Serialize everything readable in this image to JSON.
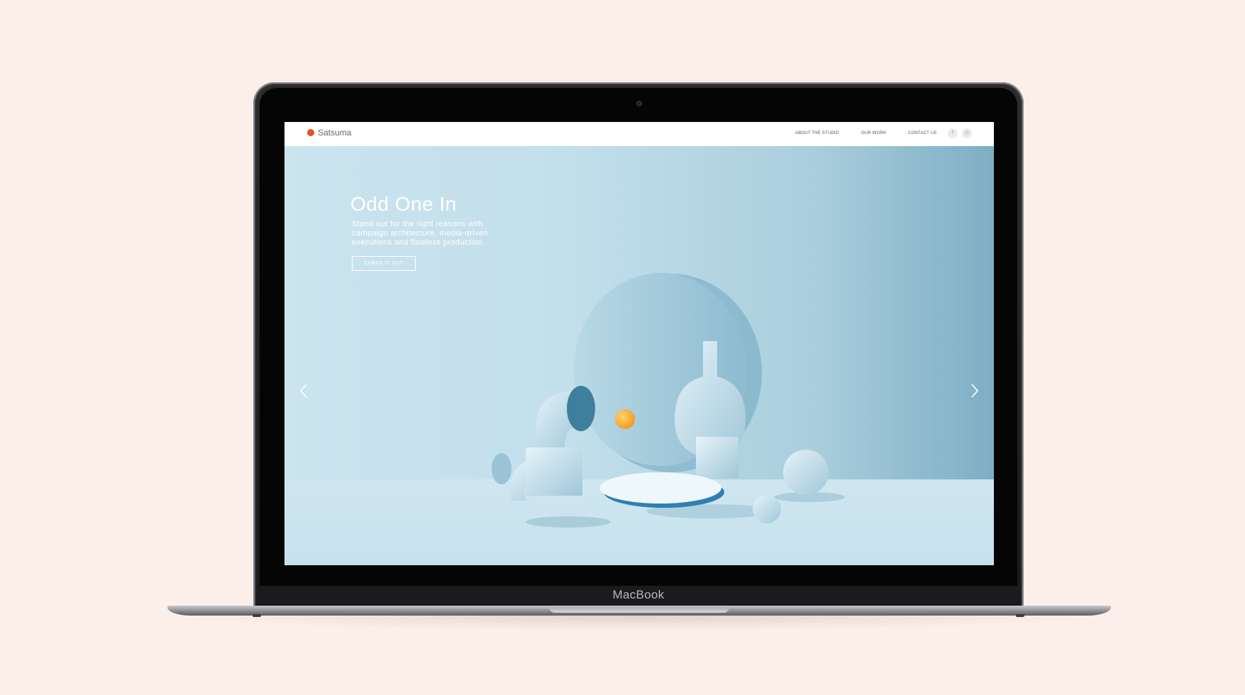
{
  "device": {
    "brand": "MacBook"
  },
  "site": {
    "logo_text": "Satsuma",
    "logo_color": "#e8501f",
    "nav": [
      {
        "label": "ABOUT THE STUDIO"
      },
      {
        "label": "OUR WORK"
      },
      {
        "label": "CONTACT US"
      }
    ],
    "social": [
      {
        "icon": "facebook-icon",
        "glyph": "f"
      },
      {
        "icon": "instagram-icon",
        "glyph": "◎"
      }
    ]
  },
  "hero": {
    "title": "Odd One In",
    "subtitle": "Stand out for the right reasons with campaign architecture, media-driven executions and flawless production.",
    "cta_label": "CHECK IT OUT",
    "prev_icon": "chevron-left-icon",
    "next_icon": "chevron-right-icon"
  },
  "colors": {
    "page_background": "#fcefea",
    "hero_blue": "#c2dfeb",
    "ball_orange": "#f5a623"
  }
}
